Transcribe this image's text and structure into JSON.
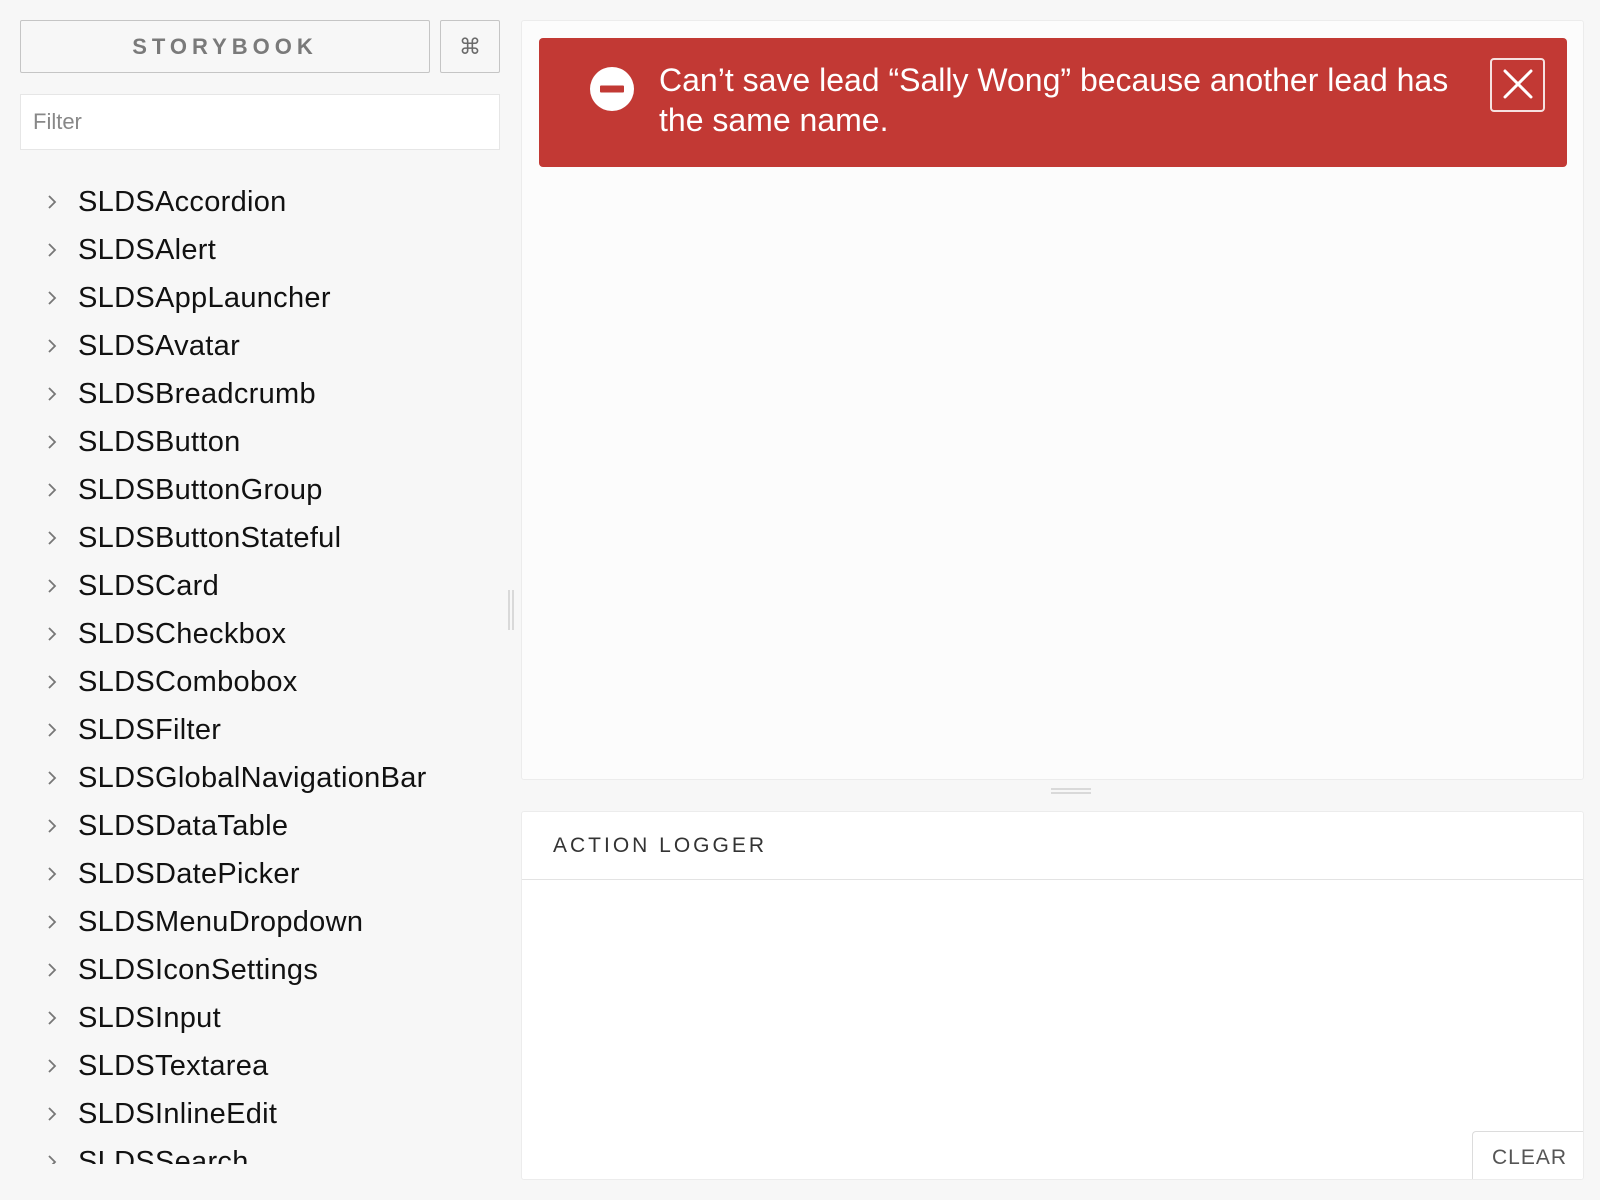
{
  "sidebar": {
    "brand_label": "STORYBOOK",
    "shortcut_symbol": "⌘",
    "filter_placeholder": "Filter",
    "items": [
      {
        "label": "SLDSAccordion"
      },
      {
        "label": "SLDSAlert"
      },
      {
        "label": "SLDSAppLauncher"
      },
      {
        "label": "SLDSAvatar"
      },
      {
        "label": "SLDSBreadcrumb"
      },
      {
        "label": "SLDSButton"
      },
      {
        "label": "SLDSButtonGroup"
      },
      {
        "label": "SLDSButtonStateful"
      },
      {
        "label": "SLDSCard"
      },
      {
        "label": "SLDSCheckbox"
      },
      {
        "label": "SLDSCombobox"
      },
      {
        "label": "SLDSFilter"
      },
      {
        "label": "SLDSGlobalNavigationBar"
      },
      {
        "label": "SLDSDataTable"
      },
      {
        "label": "SLDSDatePicker"
      },
      {
        "label": "SLDSMenuDropdown"
      },
      {
        "label": "SLDSIconSettings"
      },
      {
        "label": "SLDSInput"
      },
      {
        "label": "SLDSTextarea"
      },
      {
        "label": "SLDSInlineEdit"
      },
      {
        "label": "SLDSSearch"
      }
    ]
  },
  "preview": {
    "toast": {
      "message": "Can’t save lead “Sally Wong” because another lead has the same name.",
      "close_icon": "close-icon",
      "status_icon": "error-icon",
      "background_color": "#c23934"
    }
  },
  "addon_panel": {
    "tab_label": "ACTION LOGGER",
    "clear_label": "CLEAR"
  }
}
